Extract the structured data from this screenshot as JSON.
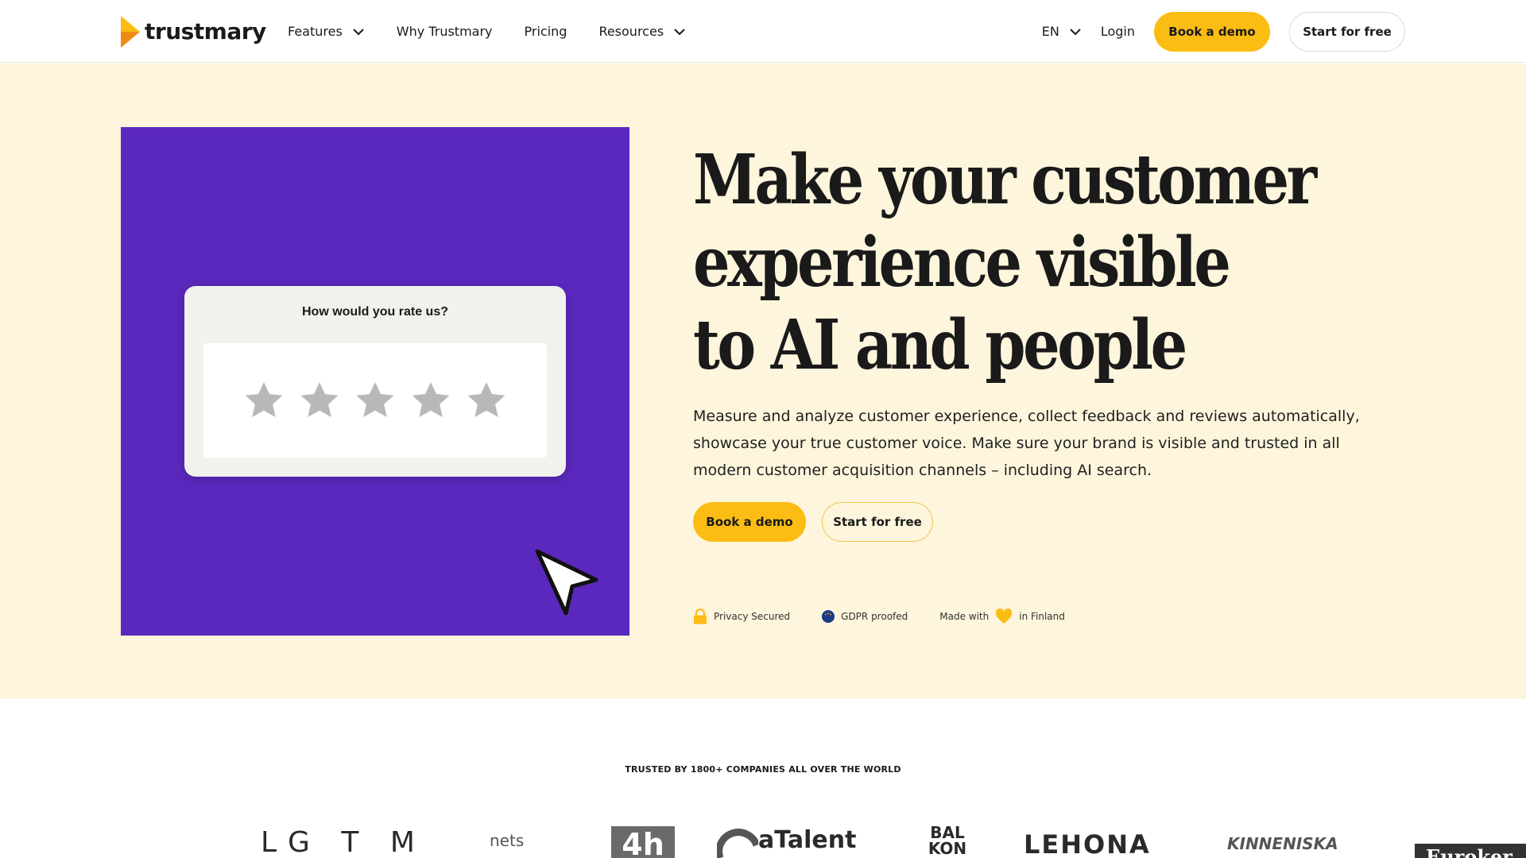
{
  "brand": {
    "name": "trustmary",
    "accent": "#fbbc13",
    "purple": "#5b28bd",
    "cream": "#fdf5dc"
  },
  "nav": {
    "items": [
      {
        "label": "Features",
        "dropdown": true
      },
      {
        "label": "Why Trustmary",
        "dropdown": false
      },
      {
        "label": "Pricing",
        "dropdown": false
      },
      {
        "label": "Resources",
        "dropdown": true
      }
    ],
    "lang": "EN",
    "login": "Login",
    "book_demo": "Book a demo",
    "start_free": "Start for free"
  },
  "hero": {
    "title_lines": [
      "Make your customer",
      "experience visible",
      "to AI and people"
    ],
    "description": "Measure and analyze customer experience, collect feedback and reviews automatically, showcase your true customer voice. Make sure your brand is visible and trusted in all modern customer acquisition channels – including AI search.",
    "book_demo": "Book a demo",
    "start_free": "Start for free",
    "rating_widget": {
      "question": "How would you rate us?",
      "stars_total": 5,
      "stars_filled": 0
    },
    "badges": {
      "privacy": "Privacy Secured",
      "gdpr": "GDPR proofed",
      "made_with": "Made with",
      "in_finland": "in Finland"
    }
  },
  "trusted": {
    "heading": "TRUSTED BY 1800+ COMPANIES ALL OVER THE WORLD",
    "logos": [
      "LG T M",
      "nets",
      "4h",
      "aTalent",
      "BAL KON",
      "LEHONA",
      "KINNENISKA",
      "Euroker"
    ]
  }
}
